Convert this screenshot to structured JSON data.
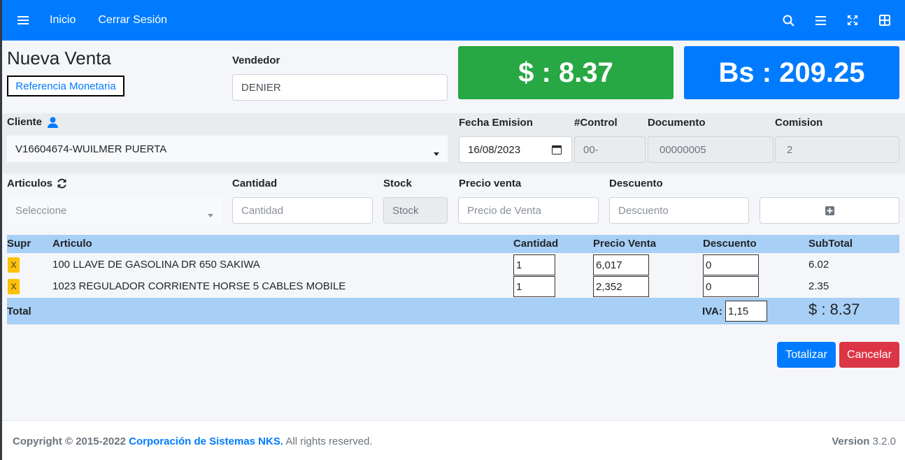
{
  "navbar": {
    "menu_icon": "hamburger-icon",
    "links": [
      "Inicio",
      "Cerrar Sesión"
    ],
    "right_icons": [
      "search-icon",
      "list-icon",
      "expand-icon",
      "grid-icon"
    ]
  },
  "page": {
    "title": "Nueva Venta",
    "ref_button": "Referencia Monetaria"
  },
  "vendedor": {
    "label": "Vendedor",
    "value": "DENIER"
  },
  "totals": {
    "usd": "$ : 8.37",
    "bs": "Bs : 209.25"
  },
  "cliente": {
    "label": "Cliente",
    "icon": "user-icon",
    "value": "V16604674-WUILMER PUERTA"
  },
  "fecha": {
    "label": "Fecha Emision",
    "value": "16/08/2023"
  },
  "control": {
    "label": "#Control",
    "value": "00-"
  },
  "documento": {
    "label": "Documento",
    "value": "00000005"
  },
  "comision": {
    "label": "Comision",
    "value": "2"
  },
  "articulos": {
    "label": "Articulos",
    "icon": "refresh-icon",
    "placeholder": "Seleccione"
  },
  "cantidad": {
    "label": "Cantidad",
    "placeholder": "Cantidad"
  },
  "stock": {
    "label": "Stock",
    "placeholder": "Stock"
  },
  "precio": {
    "label": "Precio venta",
    "placeholder": "Precio de Venta"
  },
  "descuento": {
    "label": "Descuento",
    "placeholder": "Descuento"
  },
  "table": {
    "headers": [
      "Supr",
      "Articulo",
      "Cantidad",
      "Precio Venta",
      "Descuento",
      "SubTotal"
    ],
    "remove_label": "X",
    "rows": [
      {
        "articulo": "100 LLAVE DE GASOLINA DR 650 SAKIWA",
        "cantidad": "1",
        "precio": "6,017",
        "descuento": "0",
        "subtotal": "6.02"
      },
      {
        "articulo": "1023 REGULADOR CORRIENTE HORSE 5 CABLES MOBILE",
        "cantidad": "1",
        "precio": "2,352",
        "descuento": "0",
        "subtotal": "2.35"
      }
    ],
    "total_label": "Total",
    "iva_label": "IVA:",
    "iva_value": "1,15",
    "total_value": "$ : 8.37"
  },
  "actions": {
    "totalizar": "Totalizar",
    "cancelar": "Cancelar"
  },
  "footer": {
    "copyright": "Copyright © 2015-2022",
    "company": "Corporación de Sistemas NKS.",
    "rights": "All rights reserved.",
    "version_label": "Version",
    "version_value": "3.2.0"
  },
  "colors": {
    "primary": "#007bff",
    "success": "#28a745",
    "danger": "#dc3545",
    "warning": "#ffc107",
    "table_header": "#a8cff5"
  }
}
